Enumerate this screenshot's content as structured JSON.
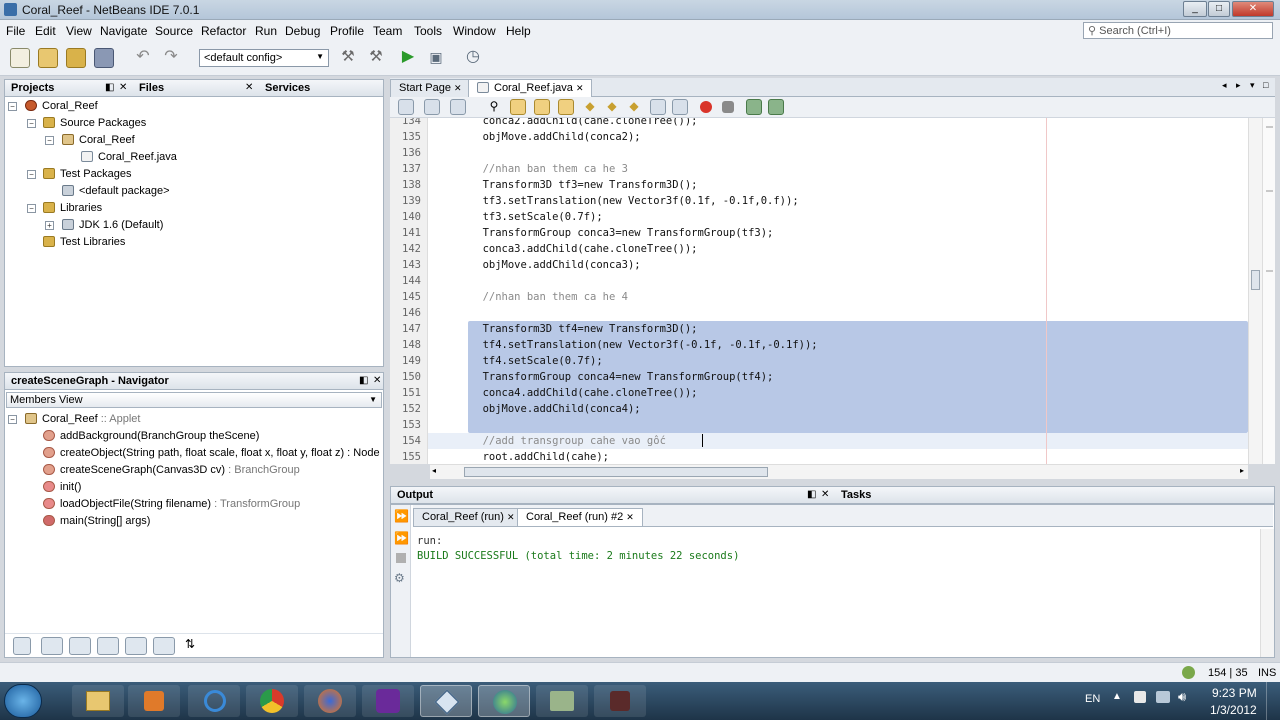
{
  "window": {
    "title": "Coral_Reef - NetBeans IDE 7.0.1"
  },
  "menu": [
    "File",
    "Edit",
    "View",
    "Navigate",
    "Source",
    "Refactor",
    "Run",
    "Debug",
    "Profile",
    "Team",
    "Tools",
    "Window",
    "Help"
  ],
  "toolbar": {
    "config": "<default config>",
    "search_placeholder": "Search (Ctrl+I)"
  },
  "projects": {
    "tabs": [
      "Projects",
      "Files",
      "Services"
    ],
    "tree": [
      "Coral_Reef",
      "Source Packages",
      "Coral_Reef",
      "Coral_Reef.java",
      "Test Packages",
      "<default package>",
      "Libraries",
      "JDK 1.6 (Default)",
      "Test Libraries"
    ]
  },
  "navigator": {
    "title": "createSceneGraph - Navigator",
    "view": "Members View",
    "class": {
      "name": "Coral_Reef",
      "sep": " :: ",
      "type": "Applet"
    },
    "members": [
      {
        "name": "addBackground",
        "params": "(BranchGroup theScene)",
        "ret": ""
      },
      {
        "name": "createObject",
        "params": "(String path, float scale, float x, float y, float z)",
        "ret": " : Node"
      },
      {
        "name": "createSceneGraph",
        "params": "(Canvas3D cv)",
        "ret": " : BranchGroup"
      },
      {
        "name": "init",
        "params": "()",
        "ret": ""
      },
      {
        "name": "loadObjectFile",
        "params": "(String filename)",
        "ret": " : TransformGroup"
      },
      {
        "name": "main",
        "params": "(String[] args)",
        "ret": ""
      }
    ]
  },
  "editor": {
    "tabs": [
      "Start Page",
      "Coral_Reef.java"
    ],
    "lines": [
      {
        "n": "134",
        "t": "        conca2.addChild(cahe.cloneTree());"
      },
      {
        "n": "135",
        "t": "        objMove.addChild(conca2);"
      },
      {
        "n": "136",
        "t": ""
      },
      {
        "n": "137",
        "t": "        //nhan ban them ca he 3"
      },
      {
        "n": "138",
        "t": "        Transform3D tf3=new Transform3D();"
      },
      {
        "n": "139",
        "t": "        tf3.setTranslation(new Vector3f(0.1f, -0.1f,0.f));"
      },
      {
        "n": "140",
        "t": "        tf3.setScale(0.7f);"
      },
      {
        "n": "141",
        "t": "        TransformGroup conca3=new TransformGroup(tf3);"
      },
      {
        "n": "142",
        "t": "        conca3.addChild(cahe.cloneTree());"
      },
      {
        "n": "143",
        "t": "        objMove.addChild(conca3);"
      },
      {
        "n": "144",
        "t": ""
      },
      {
        "n": "145",
        "t": "        //nhan ban them ca he 4"
      },
      {
        "n": "146",
        "t": ""
      },
      {
        "n": "147",
        "t": "        Transform3D tf4=new Transform3D();"
      },
      {
        "n": "148",
        "t": "        tf4.setTranslation(new Vector3f(-0.1f, -0.1f,-0.1f));"
      },
      {
        "n": "149",
        "t": "        tf4.setScale(0.7f);"
      },
      {
        "n": "150",
        "t": "        TransformGroup conca4=new TransformGroup(tf4);"
      },
      {
        "n": "151",
        "t": "        conca4.addChild(cahe.cloneTree());"
      },
      {
        "n": "152",
        "t": "        objMove.addChild(conca4);"
      },
      {
        "n": "153",
        "t": ""
      },
      {
        "n": "154",
        "t": "        //add transgroup cahe vao gốc"
      },
      {
        "n": "155",
        "t": "        root.addChild(cahe);"
      }
    ]
  },
  "output": {
    "title": "Output",
    "tasks": "Tasks",
    "tabs": [
      "Coral_Reef (run)",
      "Coral_Reef (run) #2"
    ],
    "lines": [
      "run:",
      "BUILD SUCCESSFUL (total time: 2 minutes 22 seconds)"
    ]
  },
  "status": {
    "position": "154 | 35",
    "mode": "INS"
  },
  "taskbar": {
    "lang": "EN",
    "time": "9:23 PM",
    "date": "1/3/2012"
  }
}
